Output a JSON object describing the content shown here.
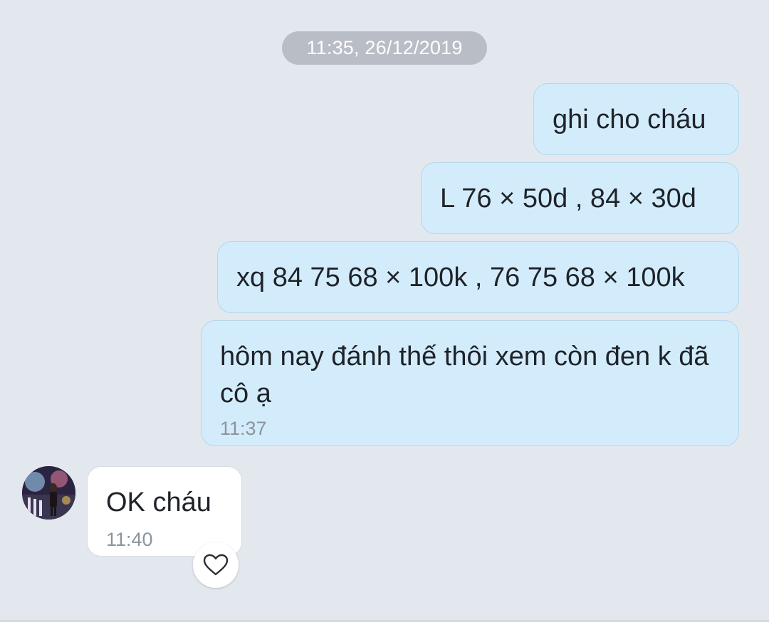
{
  "chat": {
    "date_separator": "11:35, 26/12/2019",
    "messages": [
      {
        "direction": "outgoing",
        "text": "ghi cho cháu"
      },
      {
        "direction": "outgoing",
        "text": "L 76 × 50d , 84 × 30d"
      },
      {
        "direction": "outgoing",
        "text": "xq 84 75 68 × 100k , 76 75 68 × 100k"
      },
      {
        "direction": "outgoing",
        "text": "hôm nay đánh thế thôi xem còn đen k đã cô ạ",
        "time": "11:37"
      },
      {
        "direction": "incoming",
        "text": "OK cháu",
        "time": "11:40"
      }
    ],
    "reaction_icon": "heart-outline-icon",
    "avatar_icon": "contact-avatar"
  },
  "colors": {
    "background": "#e3e8ef",
    "outgoing_bubble": "#d3ecfc",
    "incoming_bubble": "#ffffff",
    "date_pill": "#b9bec6",
    "timestamp": "#8b949d"
  }
}
